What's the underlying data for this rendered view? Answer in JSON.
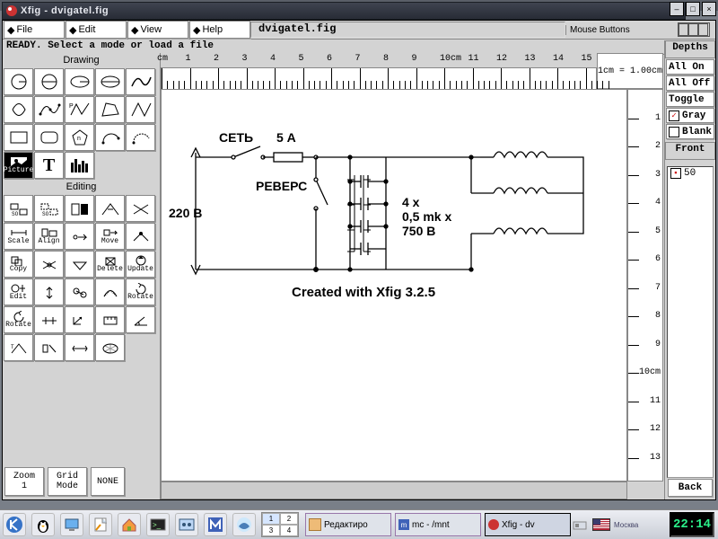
{
  "window": {
    "title": "Xfig - dvigatel.fig",
    "buttons": {
      "min": "–",
      "max": "□",
      "close": "×"
    }
  },
  "menus": {
    "file": "File",
    "edit": "Edit",
    "view": "View",
    "help": "Help"
  },
  "filename": "dvigatel.fig",
  "mouse_label": "Mouse Buttons",
  "status": "READY. Select a mode or load a file",
  "sections": {
    "drawing": "Drawing",
    "editing": "Editing"
  },
  "zoom": {
    "label": "Zoom",
    "value": "1"
  },
  "grid": {
    "label": "Grid",
    "sub": "Mode",
    "none": "NONE"
  },
  "ruler": {
    "unit_label": "1cm = 1.00cm",
    "h_nums": [
      "cm",
      "1",
      "2",
      "3",
      "4",
      "5",
      "6",
      "7",
      "8",
      "9",
      "10cm",
      "11",
      "12",
      "13",
      "14",
      "15"
    ],
    "v_nums": [
      "1",
      "2",
      "3",
      "4",
      "5",
      "6",
      "7",
      "8",
      "9",
      "10cm",
      "11",
      "12",
      "13"
    ]
  },
  "depths": {
    "header": "Depths",
    "all_on": "All On",
    "all_off": "All Off",
    "toggle": "Toggle",
    "gray": "Gray",
    "blank": "Blank",
    "front": "Front",
    "item": "50",
    "back": "Back"
  },
  "schematic": {
    "voltage": "220 В",
    "switch": "СЕТЬ",
    "fuse": "5 А",
    "reverse": "РЕВЕРС",
    "cap_spec1": "4 x",
    "cap_spec2": "0,5 mk x",
    "cap_spec3": "750 В",
    "credit": "Created with Xfig 3.2.5"
  },
  "edit_tools": {
    "scale": "Scale",
    "align": "Align",
    "move": "Move",
    "copy": "Copy",
    "delete": "Delete",
    "update": "Update",
    "edit": "Edit",
    "rotate1": "Rotate",
    "rotate2": "Rotate"
  },
  "taskbar": {
    "desks": [
      "1",
      "2",
      "3",
      "4"
    ],
    "task1": "Редактиро",
    "task2": "mc - /mnt",
    "task3": "Xfig - dv",
    "locale": "Москва",
    "clock": "22:14"
  }
}
